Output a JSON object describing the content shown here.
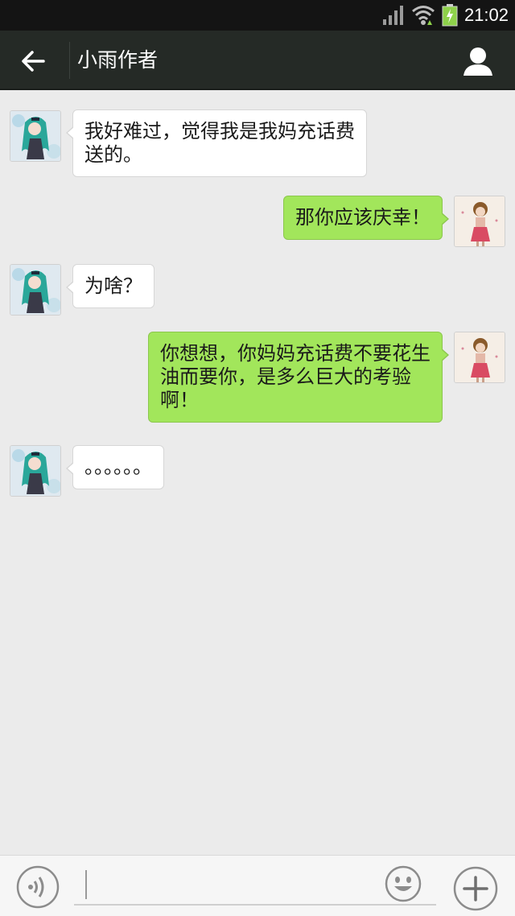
{
  "status_bar": {
    "time": "21:02",
    "icons": [
      "signal-icon",
      "wifi-icon",
      "battery-charging-icon"
    ]
  },
  "header": {
    "title": "小雨作者",
    "back_icon": "arrow-left-icon",
    "profile_icon": "person-icon"
  },
  "messages": [
    {
      "side": "left",
      "text_line1": "我好难过，觉得我是我妈充话费",
      "text_line2": "送的。"
    },
    {
      "side": "right",
      "text_line1": "那你应该庆幸！"
    },
    {
      "side": "left",
      "text_line1": "为啥？"
    },
    {
      "side": "right",
      "text_line1": "你想想，你妈妈充话费不要花生",
      "text_line2": "油而要你，是多么巨大的考验",
      "text_line3": "啊！"
    },
    {
      "side": "left",
      "text_line1": "。。。。。。"
    }
  ],
  "input_bar": {
    "voice_icon": "voice-icon",
    "input_value": "",
    "emoji_icon": "smiley-icon",
    "plus_icon": "plus-icon"
  },
  "colors": {
    "header_bg": "#252a26",
    "chat_bg": "#ebebeb",
    "outgoing_bubble": "#a2e65b",
    "incoming_bubble": "#ffffff"
  }
}
